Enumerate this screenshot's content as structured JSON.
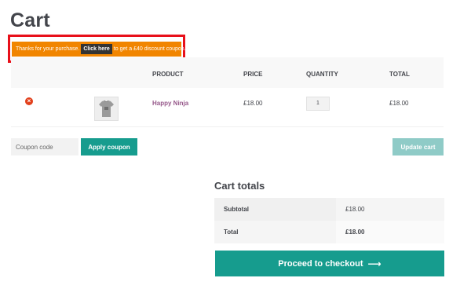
{
  "page": {
    "title": "Cart"
  },
  "notice": {
    "text_before": "Thanks for your purchase.",
    "link_label": "Click here",
    "text_after": "to get a £40 discount coupon.",
    "bg_color": "#f18500",
    "highlight_color": "#e8101a"
  },
  "cart": {
    "headers": {
      "product": "PRODUCT",
      "price": "PRICE",
      "quantity": "QUANTITY",
      "total": "TOTAL"
    },
    "items": [
      {
        "name": "Happy Ninja",
        "price": "£18.00",
        "quantity": "1",
        "total": "£18.00",
        "thumbnail_icon": "tshirt-icon",
        "remove_icon": "remove-icon"
      }
    ]
  },
  "coupon": {
    "placeholder": "Coupon code",
    "apply_label": "Apply coupon"
  },
  "update_label": "Update cart",
  "totals": {
    "title": "Cart totals",
    "rows": [
      {
        "label": "Subtotal",
        "value": "£18.00"
      },
      {
        "label": "Total",
        "value": "£18.00"
      }
    ]
  },
  "checkout": {
    "label": "Proceed to checkout",
    "arrow": "⟶"
  },
  "colors": {
    "accent": "#169c8e",
    "accent_disabled": "#8fcbc7",
    "product_link": "#96588a",
    "remove": "#e2401c"
  }
}
